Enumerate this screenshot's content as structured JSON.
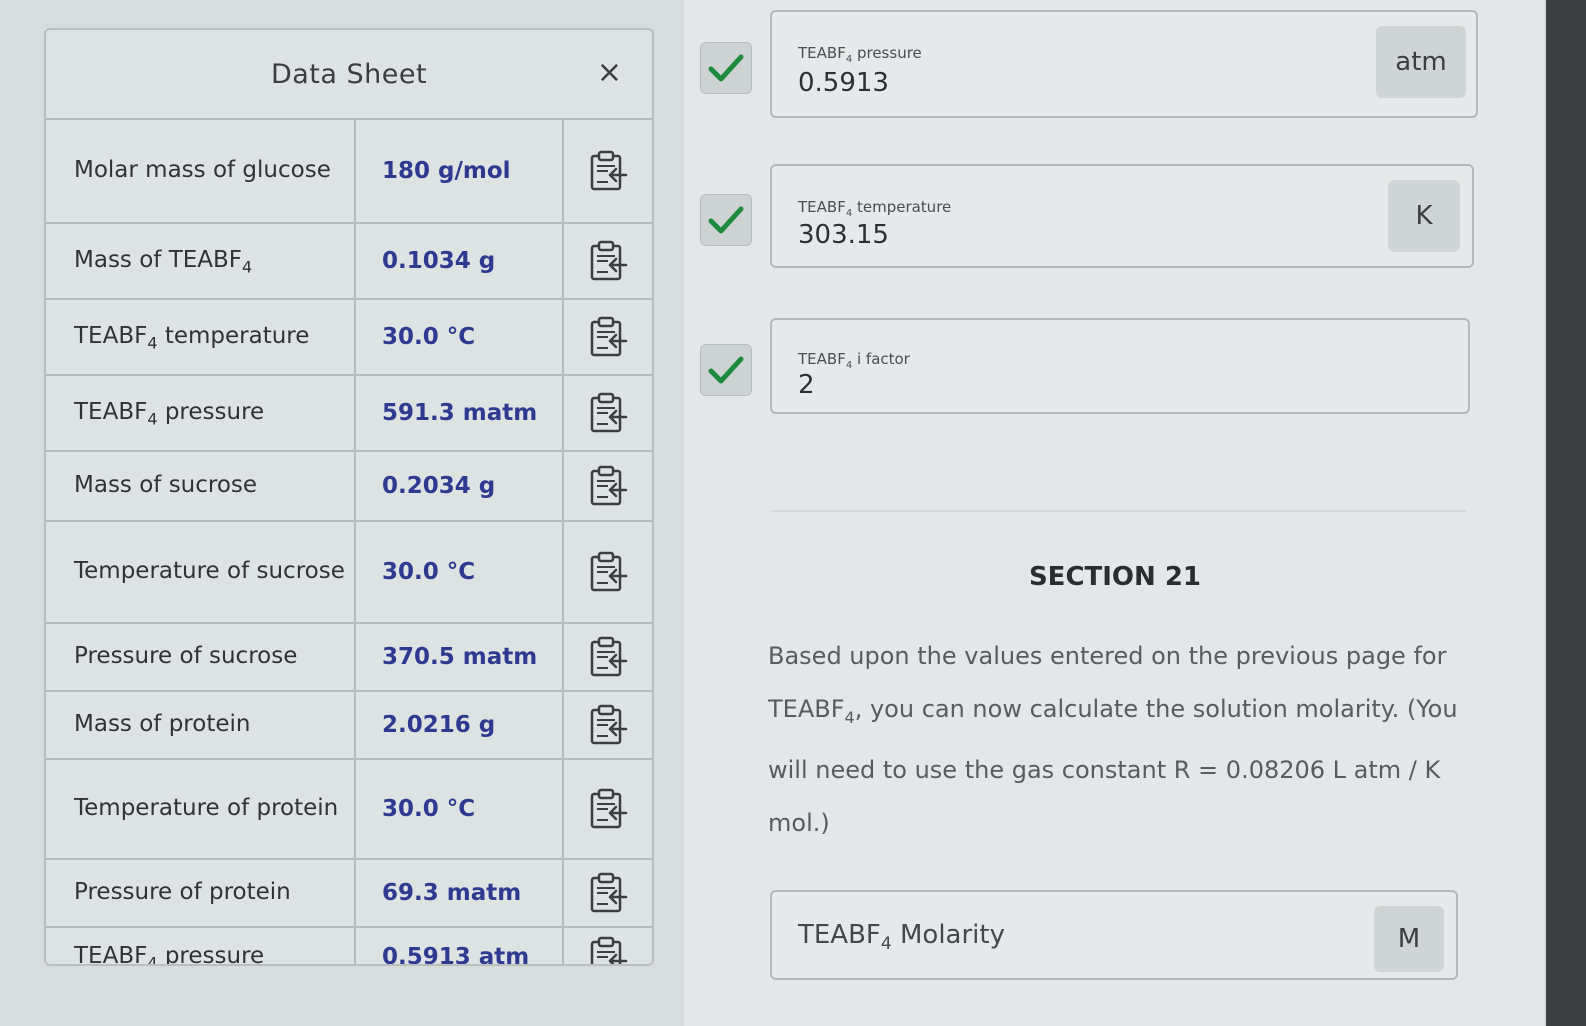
{
  "data_sheet": {
    "title": "Data Sheet",
    "close_icon": "×",
    "rows": [
      {
        "label": "Molar mass of glucose",
        "value": "180 g/mol"
      },
      {
        "label_pre": "Mass of TEABF",
        "label_sub": "4",
        "label_post": "",
        "value": "0.1034 g"
      },
      {
        "label_pre": "TEABF",
        "label_sub": "4",
        "label_post": " temperature",
        "value": "30.0 °C"
      },
      {
        "label_pre": "TEABF",
        "label_sub": "4",
        "label_post": " pressure",
        "value": "591.3 matm"
      },
      {
        "label": "Mass of sucrose",
        "value": "0.2034 g"
      },
      {
        "label": "Temperature of sucrose",
        "value": "30.0 °C"
      },
      {
        "label": "Pressure of sucrose",
        "value": "370.5 matm"
      },
      {
        "label": "Mass of protein",
        "value": "2.0216 g"
      },
      {
        "label": "Temperature of protein",
        "value": "30.0 °C"
      },
      {
        "label": "Pressure of protein",
        "value": "69.3 matm"
      },
      {
        "label_pre": "TEABF",
        "label_sub": "4",
        "label_post": " pressure",
        "value": "0.5913 atm"
      }
    ]
  },
  "fields": [
    {
      "label_pre": "TEABF",
      "label_sub": "4",
      "label_post": " pressure",
      "value": "0.5913",
      "unit": "atm",
      "status": "correct"
    },
    {
      "label_pre": "TEABF",
      "label_sub": "4",
      "label_post": " temperature",
      "value": "303.15",
      "unit": "K",
      "status": "correct"
    },
    {
      "label_pre": "TEABF",
      "label_sub": "4",
      "label_post": " i factor",
      "value": "2",
      "unit": "",
      "status": "correct"
    }
  ],
  "section": {
    "heading": "SECTION 21",
    "text_1": "Based upon the values entered on the previous page for TEABF",
    "text_sub": "4",
    "text_2": ", you can now calculate the solution molarity. (You will need to use the gas constant R = 0.08206 L atm / K mol.)"
  },
  "molarity_field": {
    "label_pre": "TEABF",
    "label_sub": "4",
    "label_post": " Molarity",
    "unit": "M"
  },
  "icons": {
    "check": "check-icon",
    "copy": "clipboard-copy-icon",
    "close": "close-icon"
  },
  "colors": {
    "value_text": "#2d3a8f",
    "check_green": "#1e8a3c"
  }
}
